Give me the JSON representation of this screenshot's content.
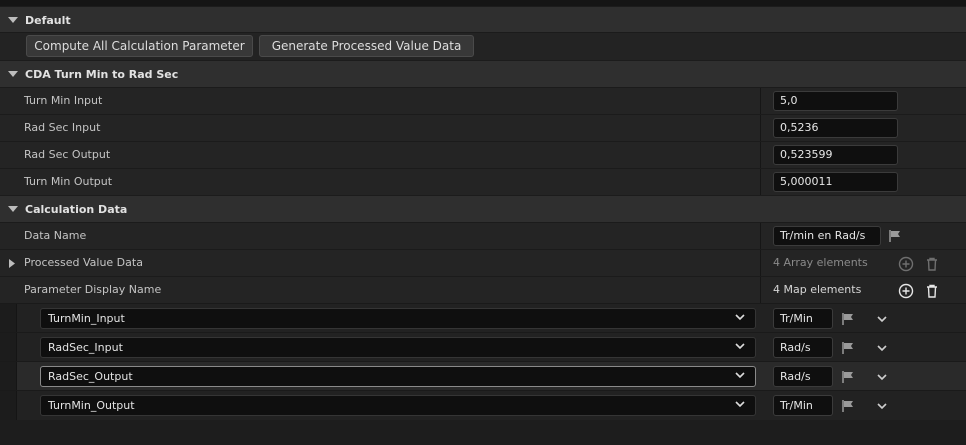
{
  "sections": {
    "default": "Default",
    "cda": "CDA Turn Min to Rad Sec",
    "calc": "Calculation Data"
  },
  "buttons": {
    "compute": "Compute All Calculation Parameter",
    "generate": "Generate Processed Value Data"
  },
  "props": [
    {
      "label": "Turn Min Input",
      "value": "5,0"
    },
    {
      "label": "Rad Sec Input",
      "value": "0,5236"
    },
    {
      "label": "Rad Sec Output",
      "value": "0,523599"
    },
    {
      "label": "Turn Min Output",
      "value": "5,000011"
    }
  ],
  "calc": {
    "data_name_label": "Data Name",
    "data_name_value": "Tr/min en Rad/s",
    "processed_label": "Processed Value Data",
    "processed_count": "4 Array elements",
    "display_label": "Parameter Display Name",
    "display_count": "4 Map elements"
  },
  "map_entries": [
    {
      "key": "TurnMin_Input",
      "value": "Tr/Min"
    },
    {
      "key": "RadSec_Input",
      "value": "Rad/s"
    },
    {
      "key": "RadSec_Output",
      "value": "Rad/s"
    },
    {
      "key": "TurnMin_Output",
      "value": "Tr/Min"
    }
  ],
  "colors": {
    "panel": "#242424",
    "header": "#2f2f2f",
    "field": "#0f0f0f"
  }
}
